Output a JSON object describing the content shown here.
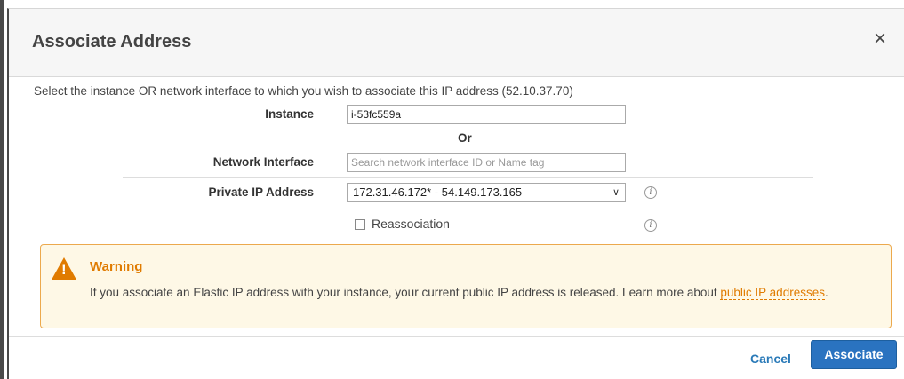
{
  "dialog": {
    "title": "Associate Address",
    "close_icon": "×"
  },
  "intro": "Select the instance OR network interface to which you wish to associate this IP address (52.10.37.70)",
  "instance": {
    "label": "Instance",
    "value": "i-53fc559a"
  },
  "or_label": "Or",
  "network_interface": {
    "label": "Network Interface",
    "placeholder": "Search network interface ID or Name tag"
  },
  "private_ip": {
    "label": "Private IP Address",
    "selected": "172.31.46.172* - 54.149.173.165"
  },
  "reassociation": {
    "label": "Reassociation",
    "checked": false
  },
  "warning": {
    "title": "Warning",
    "text": "If you associate an Elastic IP address with your instance, your current public IP address is released. Learn more about ",
    "link": "public IP addresses",
    "suffix": "."
  },
  "footer": {
    "cancel_label": "Cancel",
    "associate_label": "Associate"
  },
  "colors": {
    "accent": "#2a73c0",
    "warning": "#e07b00",
    "warning_bg": "#fef8e6"
  }
}
